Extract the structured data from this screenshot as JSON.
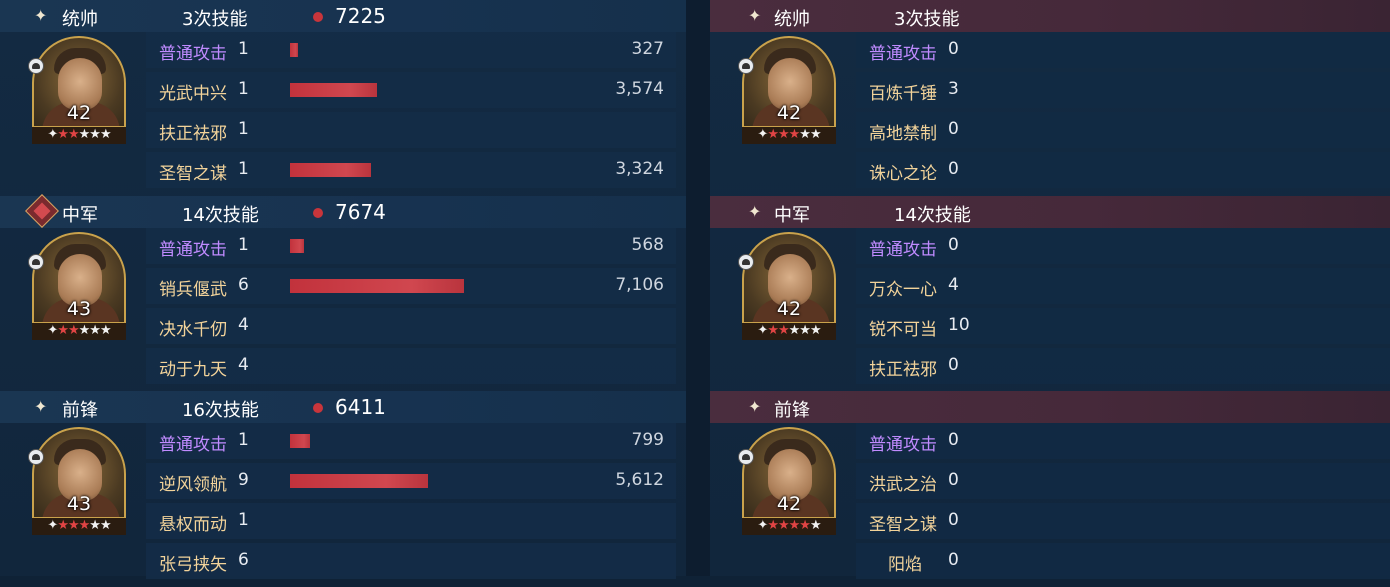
{
  "left": {
    "sections": [
      {
        "role": "统帅",
        "role_icon": "sparkle-icon",
        "skills": "3次技能",
        "power": "7225",
        "level": "42",
        "stars_red": 2,
        "rows": [
          {
            "name": "普通攻击",
            "count": "1",
            "damage": "327",
            "bar": 0.018,
            "basic": true
          },
          {
            "name": "光武中兴",
            "count": "1",
            "damage": "3,574",
            "bar": 0.2
          },
          {
            "name": "扶正祛邪",
            "count": "1",
            "damage": "",
            "bar": 0
          },
          {
            "name": "圣智之谋",
            "count": "1",
            "damage": "3,324",
            "bar": 0.186
          }
        ]
      },
      {
        "role": "中军",
        "role_icon": "diamond-badge-icon",
        "skills": "14次技能",
        "power": "7674",
        "level": "43",
        "stars_red": 2,
        "rows": [
          {
            "name": "普通攻击",
            "count": "1",
            "damage": "568",
            "bar": 0.032,
            "basic": true
          },
          {
            "name": "销兵偃武",
            "count": "6",
            "damage": "7,106",
            "bar": 0.4
          },
          {
            "name": "决水千仞",
            "count": "4",
            "damage": "",
            "bar": 0
          },
          {
            "name": "动于九天",
            "count": "4",
            "damage": "",
            "bar": 0
          }
        ]
      },
      {
        "role": "前锋",
        "role_icon": "sparkle-icon",
        "skills": "16次技能",
        "power": "6411",
        "level": "43",
        "stars_red": 3,
        "rows": [
          {
            "name": "普通攻击",
            "count": "1",
            "damage": "799",
            "bar": 0.045,
            "basic": true
          },
          {
            "name": "逆风领航",
            "count": "9",
            "damage": "5,612",
            "bar": 0.316
          },
          {
            "name": "悬权而动",
            "count": "1",
            "damage": "",
            "bar": 0
          },
          {
            "name": "张弓挟矢",
            "count": "6",
            "damage": "",
            "bar": 0
          }
        ]
      }
    ]
  },
  "right": {
    "sections": [
      {
        "role": "统帅",
        "role_icon": "sparkle-icon",
        "skills": "3次技能",
        "level": "42",
        "stars_red": 3,
        "rows": [
          {
            "name": "普通攻击",
            "count": "0",
            "basic": true
          },
          {
            "name": "百炼千锤",
            "count": "3"
          },
          {
            "name": "高地禁制",
            "count": "0"
          },
          {
            "name": "诛心之论",
            "count": "0"
          }
        ]
      },
      {
        "role": "中军",
        "role_icon": "sparkle-icon",
        "skills": "14次技能",
        "level": "42",
        "stars_red": 2,
        "rows": [
          {
            "name": "普通攻击",
            "count": "0",
            "basic": true
          },
          {
            "name": "万众一心",
            "count": "4"
          },
          {
            "name": "锐不可当",
            "count": "10"
          },
          {
            "name": "扶正祛邪",
            "count": "0"
          }
        ]
      },
      {
        "role": "前锋",
        "role_icon": "sparkle-icon",
        "skills": "",
        "level": "42",
        "stars_red": 4,
        "rows": [
          {
            "name": "普通攻击",
            "count": "0",
            "basic": true
          },
          {
            "name": "洪武之治",
            "count": "0"
          },
          {
            "name": "圣智之谋",
            "count": "0"
          },
          {
            "name": "阳焰",
            "count": "0"
          }
        ]
      }
    ]
  },
  "colors": {
    "bar": "#c8353b",
    "basic_skill": "#c08bff",
    "skill_name": "#f2d39a",
    "enemy_header": "#4a2d3e"
  }
}
